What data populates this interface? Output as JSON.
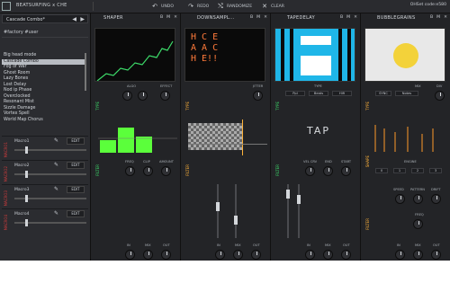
{
  "app": {
    "title": "BEATSURFING x CHE",
    "status": "OHSet code:e580"
  },
  "toolbar": {
    "undo": "UNDO",
    "redo": "REDO",
    "randomize": "RANDOMIZE",
    "clear": "CLEAR"
  },
  "sidebar": {
    "preset_current": "Cascade Combo*",
    "tags": "#factory   #user",
    "presets": [
      "Big head mode",
      "Cascade Combo",
      "Fog of War",
      "Ghost Room",
      "Lazy Bones",
      "Lost Delay",
      "Nod ip Phase",
      "Overclocked",
      "Resonant Mist",
      "Sizzle Damage",
      "Vortex Spell",
      "World Map Chorus"
    ],
    "selected_index": 1,
    "macros": [
      {
        "label": "Macro1",
        "tag": "MACRO1",
        "edit": "EDIT"
      },
      {
        "label": "Macro2",
        "tag": "MACRO2",
        "edit": "EDIT"
      },
      {
        "label": "Macro3",
        "tag": "MACRO3",
        "edit": "EDIT"
      },
      {
        "label": "Macro4",
        "tag": "MACRO4",
        "edit": "EDIT"
      }
    ]
  },
  "panels": {
    "shaper": {
      "title": "SHAPER",
      "type": "TYPE",
      "filter": "FILTER",
      "labels": [
        "ALGO",
        "EFFECT",
        "FREQ",
        "CLIP",
        "AMOUNT",
        "IN",
        "MIX",
        "OUT"
      ]
    },
    "downsampler": {
      "title": "DOWNSAMPL...",
      "type": "TYPE",
      "filter": "FILTER",
      "labels": [
        "JITTER",
        "IN",
        "MIX",
        "OUT"
      ],
      "screen_text": "H C E\nA A C\nH E!!"
    },
    "tapedelay": {
      "title": "TAPEDELAY",
      "type": "TYPE",
      "filter": "FILTER",
      "labels": [
        "TYPE",
        "VEL CRV",
        "END",
        "START",
        "IN",
        "MIX",
        "OUT"
      ],
      "modes": [
        "Ppl",
        "Beats",
        "Hifi"
      ],
      "tap": "TAP"
    },
    "bubblegrains": {
      "title": "BUBBLEGRAINS",
      "type": "TYPE",
      "shape": "SHAPE",
      "filter": "FILTER",
      "sync": "SYNC",
      "notes": "Notes",
      "labels": [
        "MIX",
        "DIV",
        "ENGINE",
        "SPEED",
        "PATTERN",
        "DRIFT",
        "FREQ",
        "IN",
        "MIX",
        "OUT"
      ],
      "engine_values": [
        "0",
        "1",
        "2",
        "3"
      ]
    }
  }
}
